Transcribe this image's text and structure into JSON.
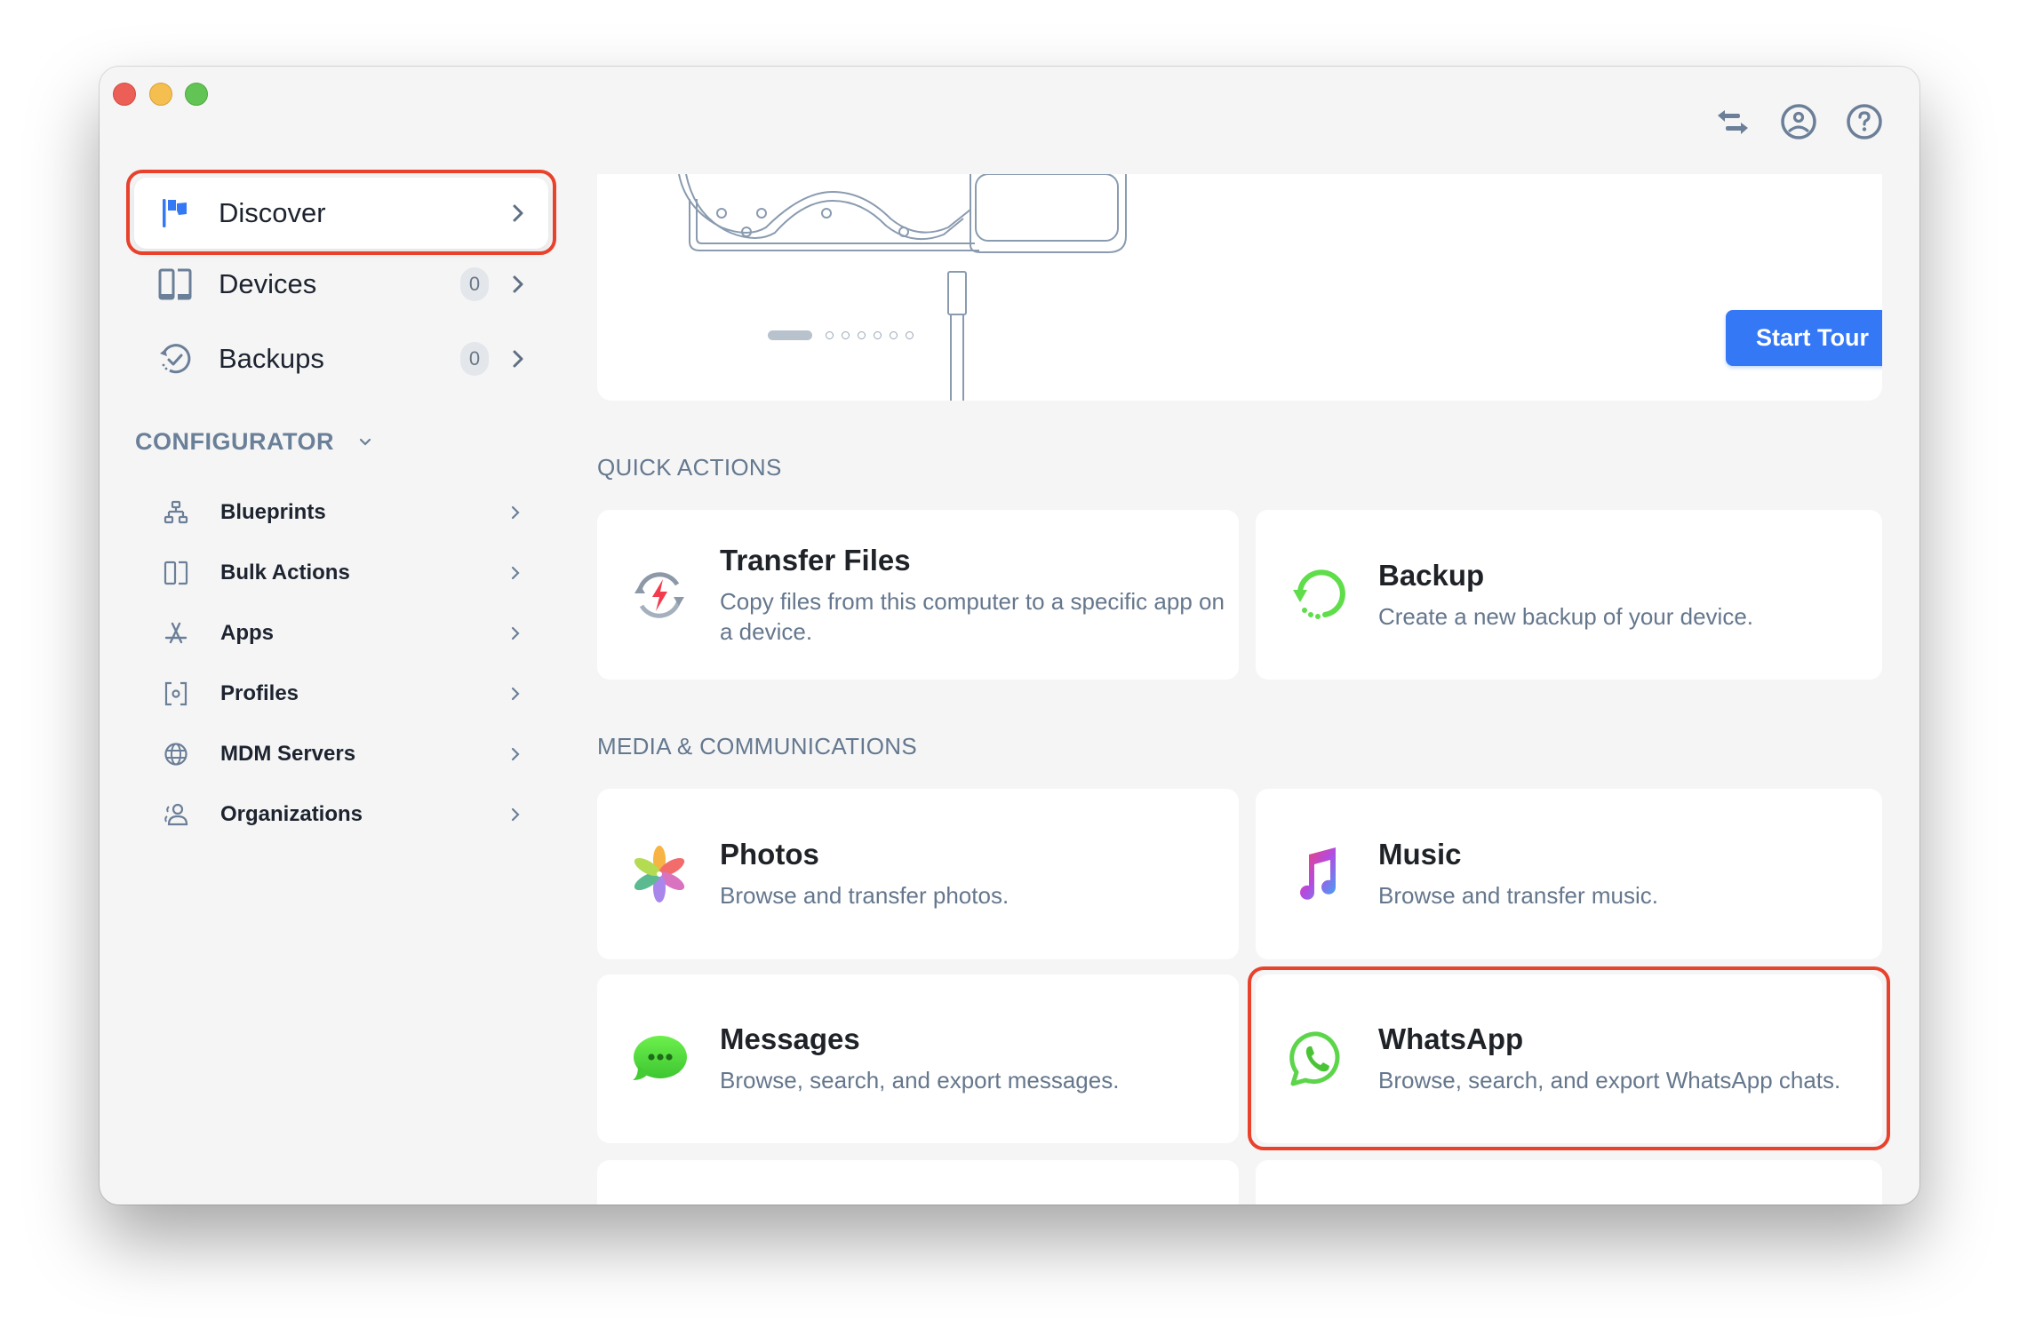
{
  "window": {
    "traffic_lights": [
      "close",
      "minimize",
      "zoom"
    ]
  },
  "toolbar": {
    "icons": [
      "transfer-arrows-icon",
      "account-icon",
      "help-icon"
    ]
  },
  "sidebar": {
    "items": [
      {
        "label": "Discover",
        "icon": "flag-icon",
        "active": true,
        "highlighted": true
      },
      {
        "label": "Devices",
        "icon": "devices-icon",
        "badge": "0"
      },
      {
        "label": "Backups",
        "icon": "backup-clock-icon",
        "badge": "0"
      }
    ],
    "configurator": {
      "title": "CONFIGURATOR",
      "expanded": true,
      "items": [
        {
          "label": "Blueprints",
          "icon": "hierarchy-icon"
        },
        {
          "label": "Bulk Actions",
          "icon": "devices-icon"
        },
        {
          "label": "Apps",
          "icon": "app-store-icon"
        },
        {
          "label": "Profiles",
          "icon": "profile-gear-icon"
        },
        {
          "label": "MDM Servers",
          "icon": "globe-icon"
        },
        {
          "label": "Organizations",
          "icon": "people-icon"
        }
      ]
    }
  },
  "hero": {
    "carousel_pages": 7,
    "carousel_current": 1,
    "start_tour_label": "Start Tour"
  },
  "quick_actions": {
    "title": "QUICK ACTIONS",
    "cards": [
      {
        "title": "Transfer Files",
        "description": "Copy files from this computer to a specific app on a device.",
        "icon": "transfer-lightning-icon"
      },
      {
        "title": "Backup",
        "description": "Create a new backup of your device.",
        "icon": "backup-icon"
      }
    ]
  },
  "media": {
    "title": "MEDIA & COMMUNICATIONS",
    "cards": [
      {
        "title": "Photos",
        "description": "Browse and transfer photos.",
        "icon": "photos-icon"
      },
      {
        "title": "Music",
        "description": "Browse and transfer music.",
        "icon": "music-icon"
      },
      {
        "title": "Messages",
        "description": "Browse, search, and export messages.",
        "icon": "messages-icon"
      },
      {
        "title": "WhatsApp",
        "description": "Browse, search, and export WhatsApp chats.",
        "icon": "whatsapp-icon",
        "highlighted": true
      }
    ]
  },
  "colors": {
    "accent": "#3478f6",
    "highlight": "#e8412c",
    "window_bg": "#f5f5f5",
    "muted_text": "#65778d"
  }
}
